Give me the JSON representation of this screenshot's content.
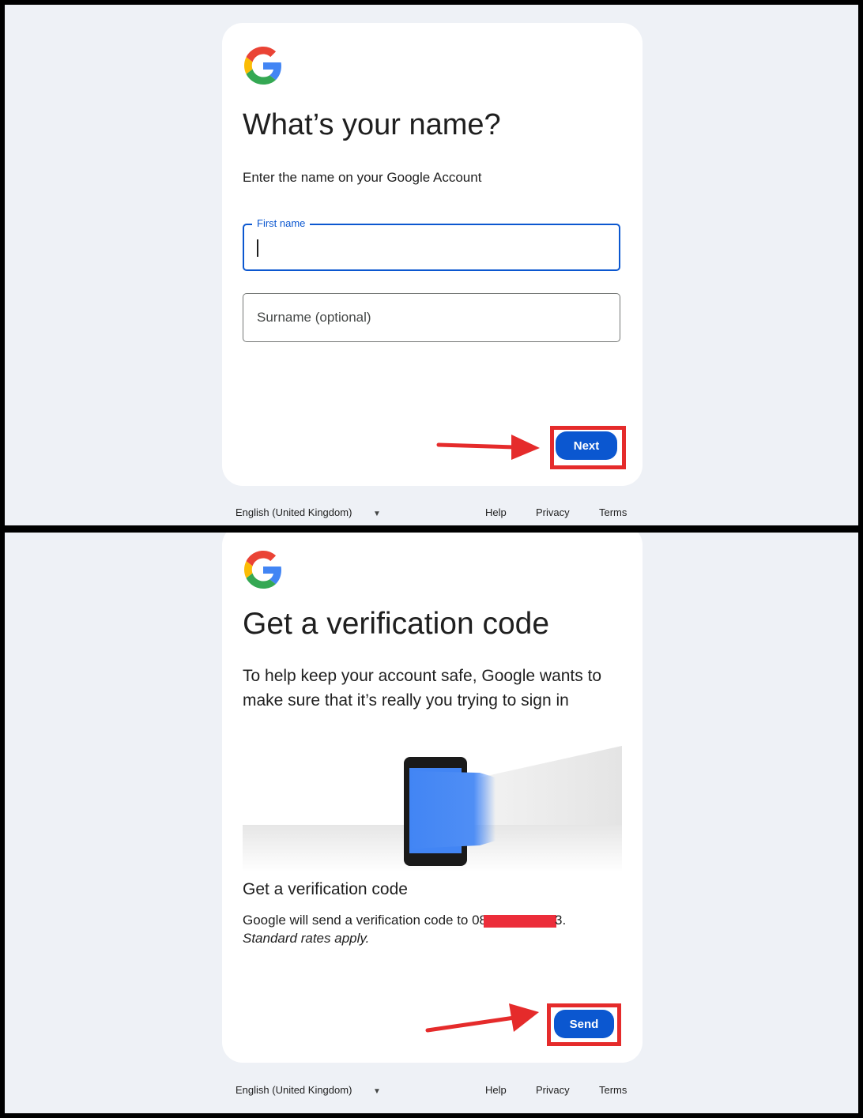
{
  "colors": {
    "page_bg": "#eef1f6",
    "card_bg": "#ffffff",
    "primary_blue": "#0b57d0",
    "annotation_red": "#e52b2b",
    "redaction_red": "#ec2d3a"
  },
  "screen1": {
    "logo_icon": "google-g-icon",
    "title": "What’s your name?",
    "subtitle": "Enter the name on your Google Account",
    "first_name": {
      "label": "First name",
      "value": ""
    },
    "surname": {
      "placeholder": "Surname (optional)",
      "value": ""
    },
    "next_button": "Next",
    "footer": {
      "language": "English (United Kingdom)",
      "help": "Help",
      "privacy": "Privacy",
      "terms": "Terms"
    }
  },
  "screen2": {
    "logo_icon": "google-g-icon",
    "title": "Get a verification code",
    "subtitle": "To help keep your account safe, Google wants to make sure that it’s really you trying to sign in",
    "illustration_icon": "phone-illustration",
    "section_heading": "Get a verification code",
    "send_text_prefix": "Google will send a verification code to 08",
    "send_text_suffix": "3.",
    "rates_note": "Standard rates apply.",
    "send_button": "Send",
    "footer": {
      "language": "English (United Kingdom)",
      "help": "Help",
      "privacy": "Privacy",
      "terms": "Terms"
    }
  }
}
